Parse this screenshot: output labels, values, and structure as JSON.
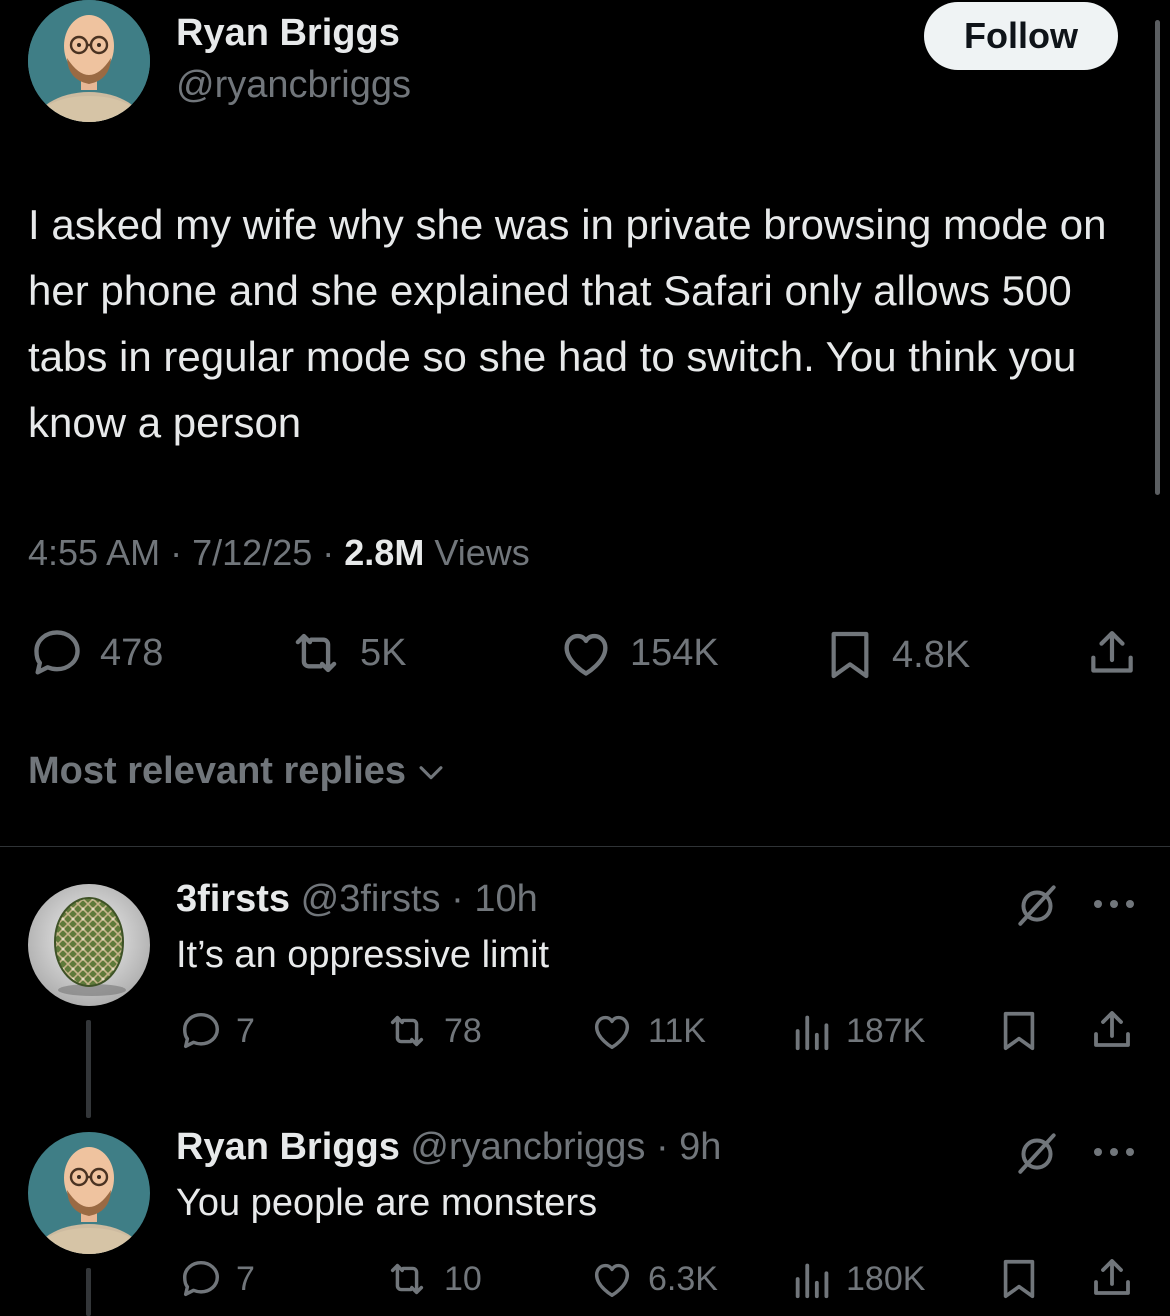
{
  "tweet": {
    "author": {
      "name": "Ryan Briggs",
      "handle": "@ryancbriggs"
    },
    "follow_label": "Follow",
    "text": "I asked my wife why she was in private browsing mode on her phone and she explained that Safari only allows 500 tabs in regular mode so she had to switch. You think you know a person",
    "time": "4:55 AM",
    "date": "7/12/25",
    "views_count": "2.8M",
    "views_label": "Views",
    "sep": "·",
    "stats": {
      "replies": "478",
      "reposts": "5K",
      "likes": "154K",
      "bookmarks": "4.8K"
    }
  },
  "replies_header": {
    "label": "Most relevant replies"
  },
  "replies": [
    {
      "name": "3firsts",
      "handle": "@3firsts",
      "time": "10h",
      "text": "It’s an oppressive limit",
      "stats": {
        "replies": "7",
        "reposts": "78",
        "likes": "11K",
        "views": "187K"
      }
    },
    {
      "name": "Ryan Briggs",
      "handle": "@ryancbriggs",
      "time": "9h",
      "text": "You people are monsters",
      "stats": {
        "replies": "7",
        "reposts": "10",
        "likes": "6.3K",
        "views": "180K"
      }
    }
  ],
  "colors": {
    "background": "#000000",
    "text": "#e7e9ea",
    "muted": "#71767b",
    "divider": "#2f3336",
    "button_bg": "#eff3f4"
  },
  "icons": [
    "reply-icon",
    "repost-icon",
    "like-icon",
    "bookmark-icon",
    "share-icon",
    "views-icon",
    "grok-icon",
    "more-icon",
    "chevron-down-icon"
  ]
}
